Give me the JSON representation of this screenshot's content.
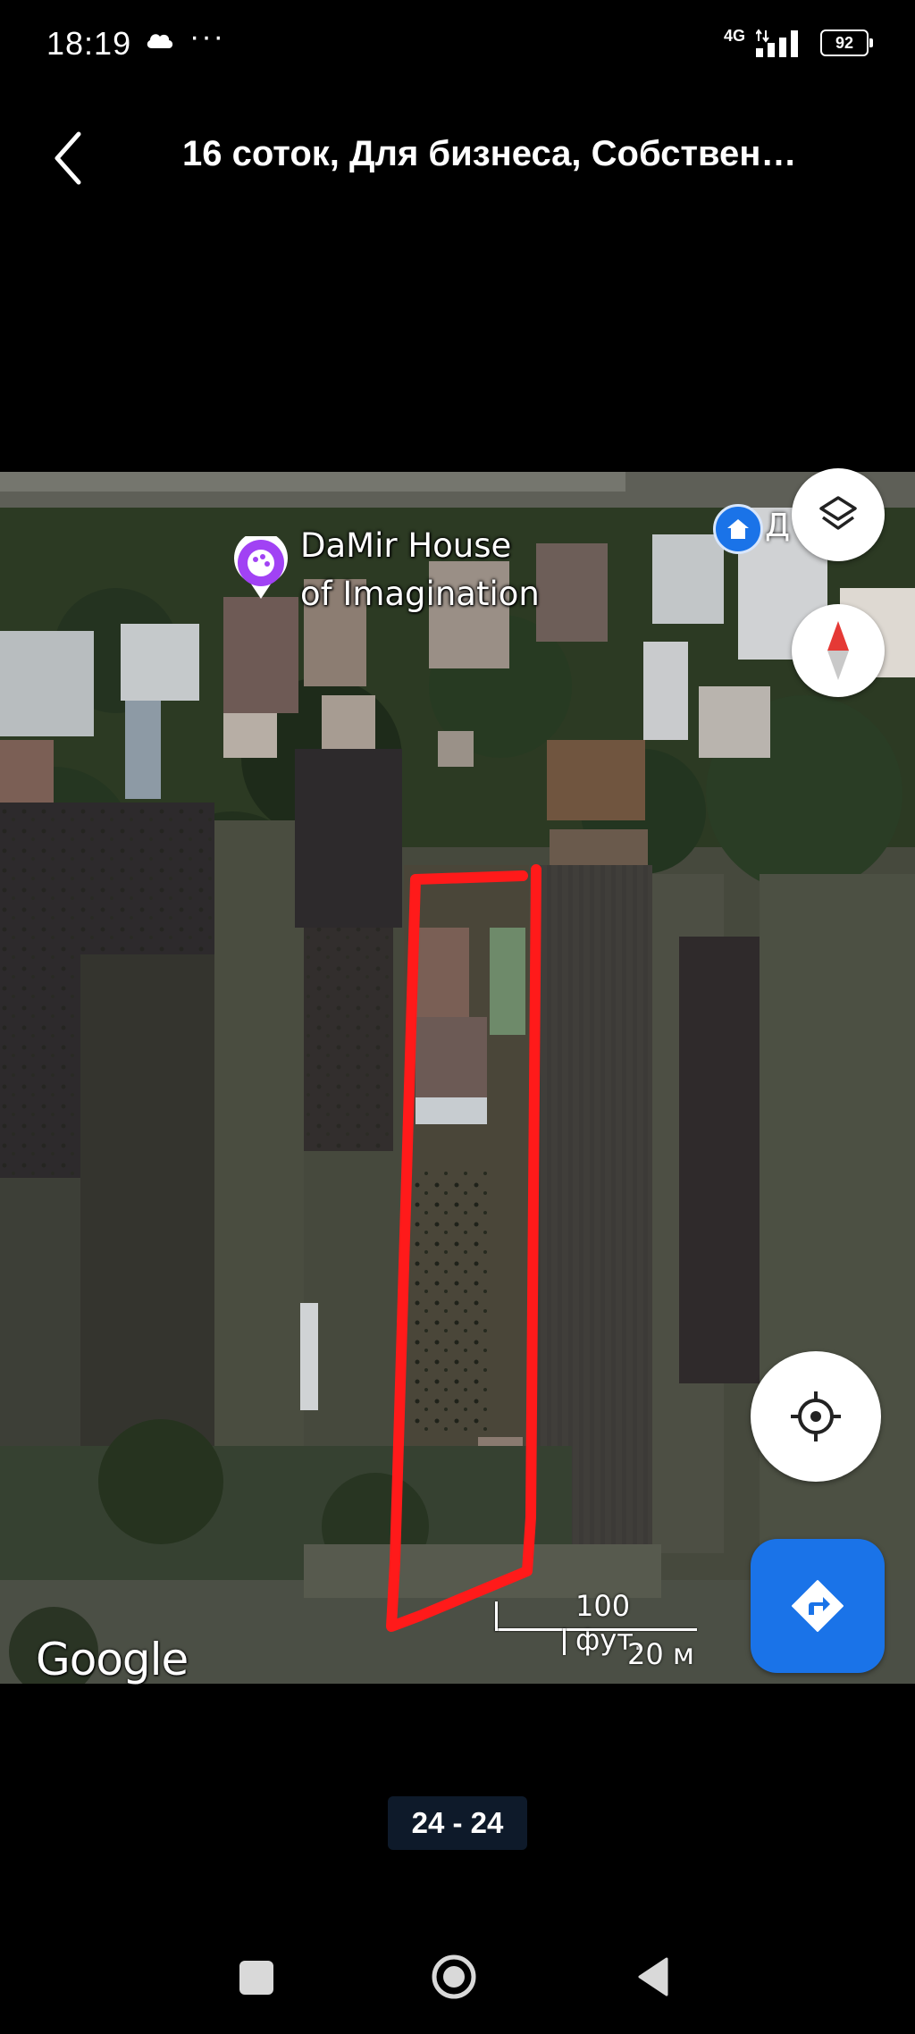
{
  "status": {
    "time": "18:19",
    "dots": "···",
    "network": "4G",
    "battery": "92"
  },
  "header": {
    "title": "16 соток, Для бизнеса, Собствен…"
  },
  "map": {
    "poi_line1": "DaMir House",
    "poi_line2": "of Imagination",
    "poi_cut_label": "Д",
    "scale_ft": "100 фут.",
    "scale_m": "20 м",
    "logo": "Google",
    "outline_color": "#ff1a1a"
  },
  "gallery": {
    "counter": "24 - 24"
  },
  "icons": {
    "back": "chevron-left-icon",
    "layers": "layers-icon",
    "compass": "compass-icon",
    "locate": "my-location-icon",
    "route": "directions-icon",
    "poi": "palette-icon",
    "home": "home-icon"
  }
}
